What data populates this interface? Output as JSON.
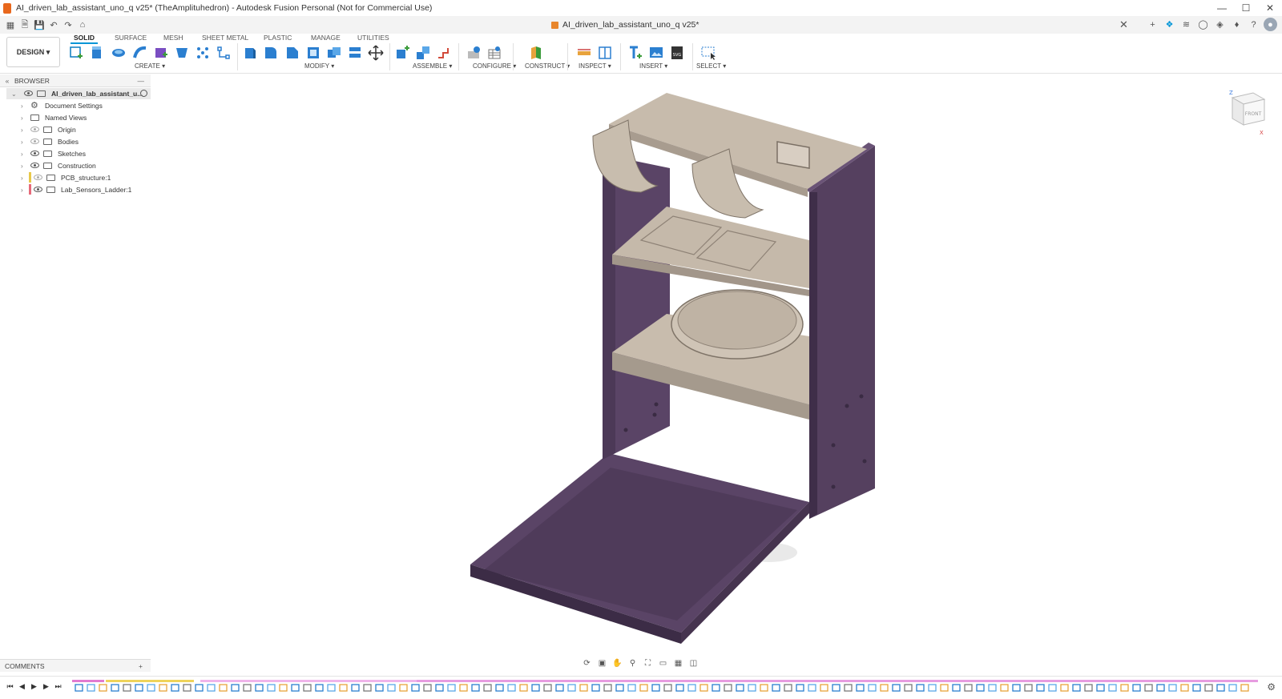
{
  "window": {
    "title": "AI_driven_lab_assistant_uno_q v25* (TheAmplituhedron) - Autodesk Fusion Personal (Not for Commercial Use)"
  },
  "document_tab": {
    "label": "AI_driven_lab_assistant_uno_q v25*"
  },
  "workspace": {
    "label": "DESIGN ▾"
  },
  "ribbon_tabs": [
    "SOLID",
    "SURFACE",
    "MESH",
    "SHEET METAL",
    "PLASTIC",
    "MANAGE",
    "UTILITIES"
  ],
  "ribbon_groups": {
    "create": "CREATE ▾",
    "modify": "MODIFY ▾",
    "assemble": "ASSEMBLE ▾",
    "configure": "CONFIGURE ▾",
    "construct": "CONSTRUCT ▾",
    "inspect": "INSPECT ▾",
    "insert": "INSERT ▾",
    "select": "SELECT ▾"
  },
  "browser": {
    "title": "BROWSER",
    "root": "AI_driven_lab_assistant_u...",
    "items": [
      {
        "label": "Document Settings"
      },
      {
        "label": "Named Views"
      },
      {
        "label": "Origin"
      },
      {
        "label": "Bodies"
      },
      {
        "label": "Sketches"
      },
      {
        "label": "Construction"
      },
      {
        "label": "PCB_structure:1"
      },
      {
        "label": "Lab_Sensors_Ladder:1"
      }
    ]
  },
  "comments": {
    "label": "COMMENTS"
  },
  "viewcube": {
    "face": "FRONT",
    "axis_z": "Z",
    "axis_x": "X"
  },
  "colors": {
    "accent": "#0696d7",
    "frame_purple": "#55405f",
    "shelf_beige": "#c9bdaf",
    "app_orange": "#e8671c"
  }
}
